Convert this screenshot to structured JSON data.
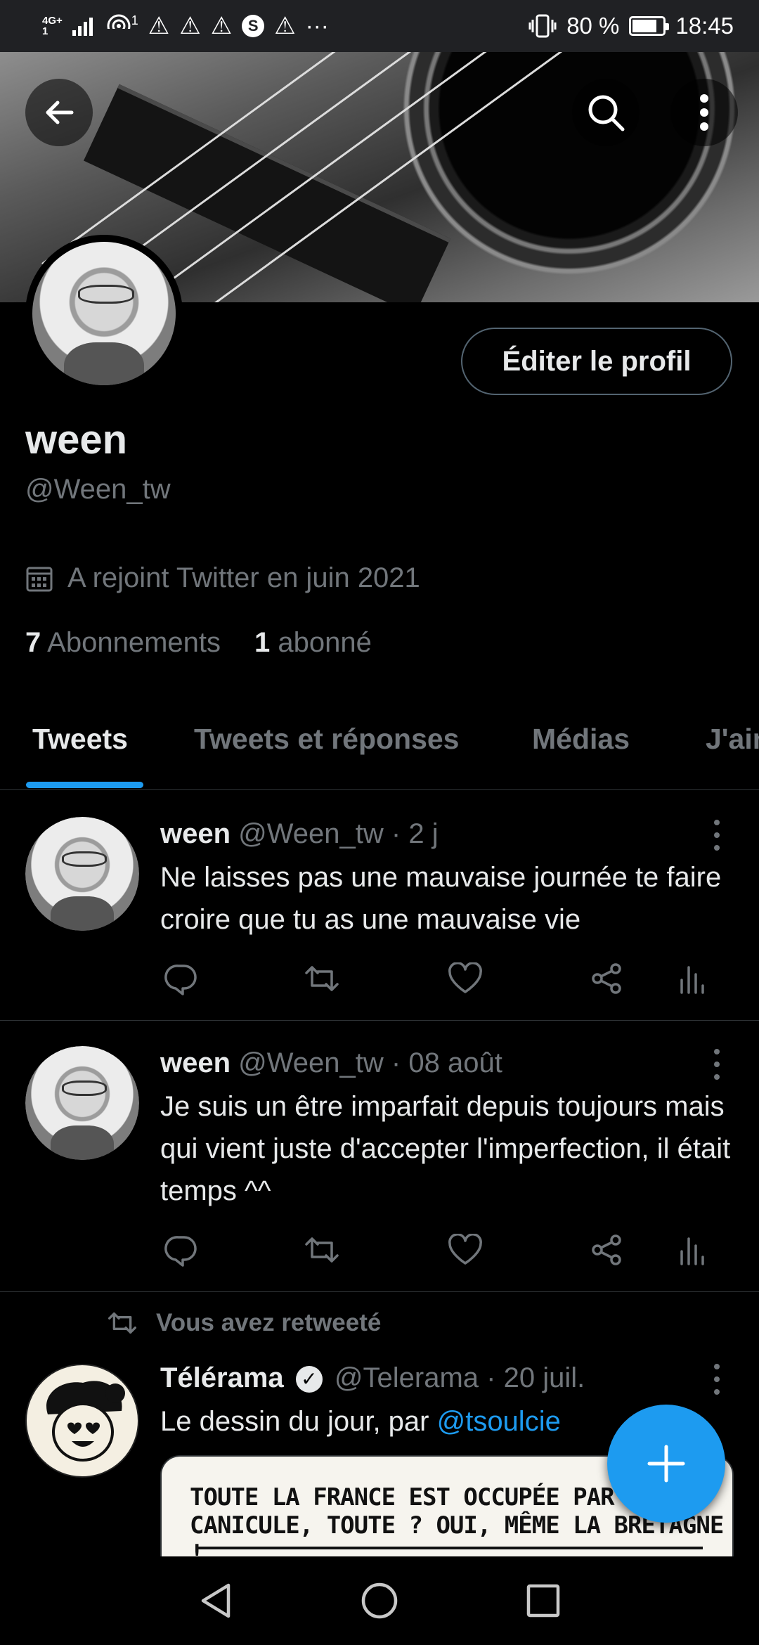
{
  "status_bar": {
    "network": "4G+",
    "network_sub": "1",
    "hotspot_count": "1",
    "more": "···",
    "battery_text": "80 %",
    "battery_level": 0.8,
    "time": "18:45"
  },
  "header": {
    "back_icon": "arrow-left-icon",
    "search_icon": "search-icon",
    "more_icon": "more-vertical-icon"
  },
  "profile": {
    "name": "ween",
    "handle": "@Ween_tw",
    "edit_label": "Éditer le profil",
    "joined": "A rejoint Twitter en juin 2021",
    "following_count": "7",
    "following_label": "Abonnements",
    "followers_count": "1",
    "followers_label": "abonné"
  },
  "tabs": [
    {
      "label": "Tweets",
      "active": true
    },
    {
      "label": "Tweets et réponses",
      "active": false
    },
    {
      "label": "Médias",
      "active": false
    },
    {
      "label": "J'aime",
      "active": false
    }
  ],
  "tweets": [
    {
      "name": "ween",
      "handle": "@Ween_tw",
      "sep": "·",
      "time": "2 j",
      "text": "Ne laisses pas une mauvaise journée te faire croire que tu as une mauvaise vie"
    },
    {
      "name": "ween",
      "handle": "@Ween_tw",
      "sep": "·",
      "time": "08 août",
      "text": "Je suis un être imparfait depuis toujours mais qui vient juste d'accepter l'imperfection, il était temps ^^"
    },
    {
      "retweet_label": "Vous avez retweeté",
      "name": "Télérama",
      "verified": "✓",
      "handle": "@Telerama",
      "sep": "·",
      "time": "20 juil.",
      "text_prefix": "Le dessin du jour, par ",
      "mention": "@tsoulcie",
      "media_caption_line1": "TOUTE LA FRANCE EST OCCUPÉE PAR LA",
      "media_caption_line2": "CANICULE, TOUTE ? OUI, MÊME LA BRETAGNE !"
    }
  ],
  "colors": {
    "accent": "#1d9bf0",
    "background": "#000000",
    "muted": "#71767b",
    "divider": "#2f3336"
  }
}
